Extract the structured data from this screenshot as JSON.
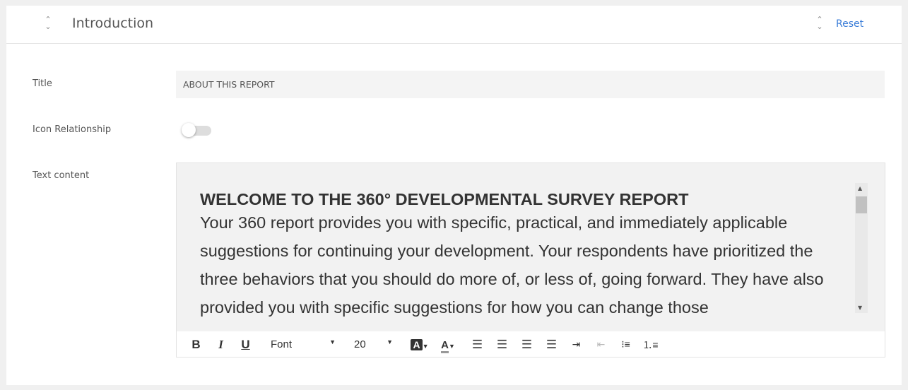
{
  "header": {
    "title": "Introduction",
    "reset_label": "Reset"
  },
  "fields": {
    "title_label": "Title",
    "title_value": "ABOUT THIS REPORT",
    "icon_relationship_label": "Icon Relationship",
    "icon_relationship_on": false,
    "text_content_label": "Text content"
  },
  "editor": {
    "heading": "WELCOME TO THE 360° DEVELOPMENTAL SURVEY REPORT",
    "body": "Your 360 report provides you with specific, practical, and immediately applicable suggestions for continuing your development. Your respondents have prioritized the three behaviors that you should do more of, or less of, going forward. They have also provided you with specific suggestions for how you can change those",
    "toolbar": {
      "bold": "B",
      "italic": "I",
      "underline": "U",
      "font": "Font",
      "size": "20",
      "bg_color": "A",
      "text_color": "A"
    }
  }
}
